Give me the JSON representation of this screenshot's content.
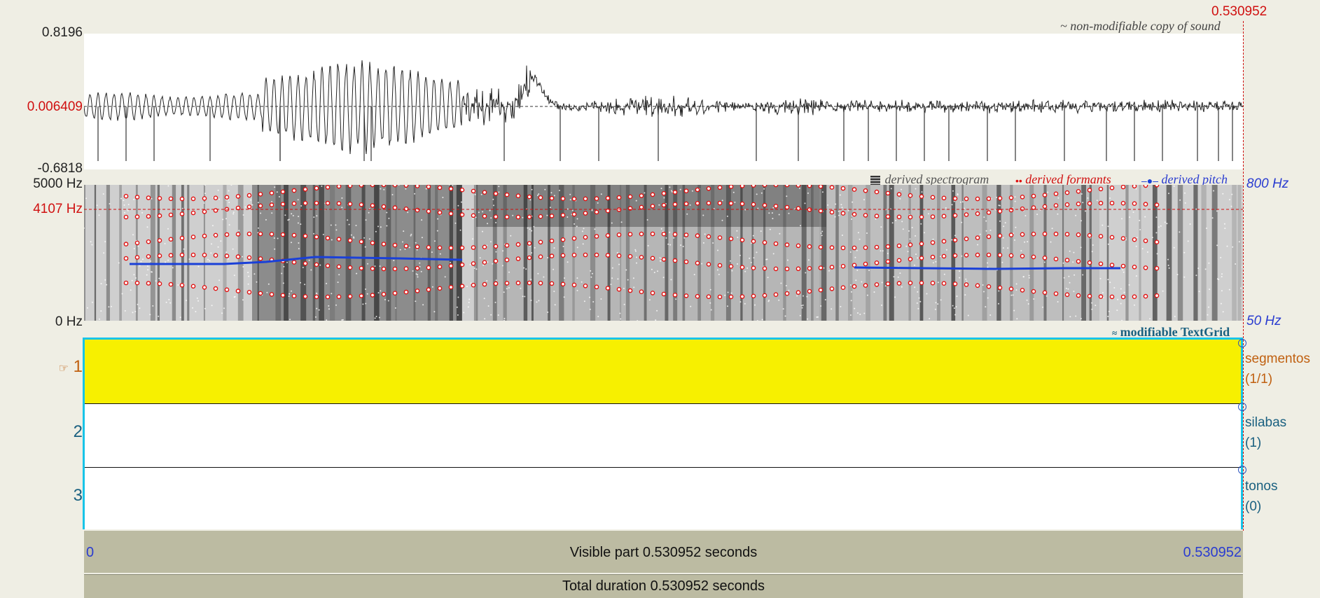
{
  "window": {
    "cursor_time": "0.530952"
  },
  "sound": {
    "copy_label": "~ non-modifiable copy of sound",
    "y_max": "0.8196",
    "y_cursor": "0.006409",
    "y_min": "-0.6818"
  },
  "spectrogram": {
    "freq_max": "5000 Hz",
    "freq_cursor": "4107 Hz",
    "freq_min": "0 Hz",
    "pitch_max": "800 Hz",
    "pitch_min": "50 Hz",
    "legend_spectrogram": "derived spectrogram",
    "legend_formants": "derived formants",
    "legend_pitch": "derived pitch"
  },
  "textgrid": {
    "label": "modifiable TextGrid",
    "tiers": [
      {
        "number": "1",
        "name": "segmentos",
        "count": "(1/1)",
        "selected": true
      },
      {
        "number": "2",
        "name": "silabas",
        "count": "(1)",
        "selected": false
      },
      {
        "number": "3",
        "name": "tonos",
        "count": "(0)",
        "selected": false
      }
    ]
  },
  "timebar": {
    "start": "0",
    "end": "0.530952",
    "visible": "Visible part 0.530952 seconds",
    "total": "Total duration 0.530952 seconds"
  },
  "colors": {
    "selected_tier": "#f7f000",
    "textgrid_border": "#18c4e8",
    "cursor": "#d01010",
    "pitch": "#1a40d8",
    "formant": "#e01010"
  }
}
